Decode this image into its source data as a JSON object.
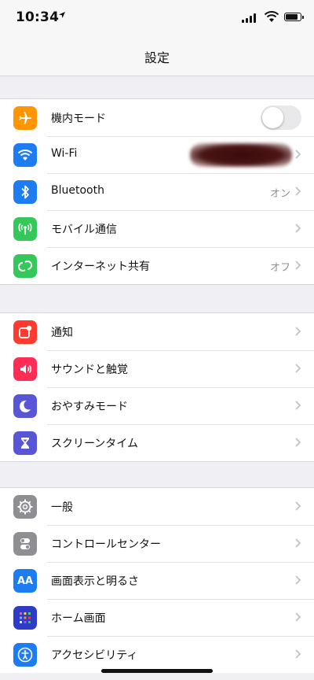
{
  "status_bar": {
    "time": "10:34"
  },
  "nav": {
    "title": "設定"
  },
  "groups": [
    {
      "rows": [
        {
          "label": "機内モード",
          "icon": "airplane-icon",
          "color": "#ff9500",
          "control": "toggle",
          "toggle_on": false
        },
        {
          "label": "Wi-Fi",
          "icon": "wifi-icon",
          "color": "#1e7cf2",
          "control": "redacted"
        },
        {
          "label": "Bluetooth",
          "icon": "bluetooth-icon",
          "color": "#1e7cf2",
          "value": "オン"
        },
        {
          "label": "モバイル通信",
          "icon": "antenna-icon",
          "color": "#34c759"
        },
        {
          "label": "インターネット共有",
          "icon": "hotspot-icon",
          "color": "#34c759",
          "value": "オフ"
        }
      ]
    },
    {
      "rows": [
        {
          "label": "通知",
          "icon": "notification-icon",
          "color": "#ff3b30"
        },
        {
          "label": "サウンドと触覚",
          "icon": "speaker-icon",
          "color": "#ff2d55"
        },
        {
          "label": "おやすみモード",
          "icon": "moon-icon",
          "color": "#5856d6"
        },
        {
          "label": "スクリーンタイム",
          "icon": "hourglass-icon",
          "color": "#5856d6"
        }
      ]
    },
    {
      "rows": [
        {
          "label": "一般",
          "icon": "gear-icon",
          "color": "#8e8e93"
        },
        {
          "label": "コントロールセンター",
          "icon": "switches-icon",
          "color": "#8e8e93"
        },
        {
          "label": "画面表示と明るさ",
          "icon": "text-size-icon",
          "color": "#1e7cf2",
          "icon_text": "AA"
        },
        {
          "label": "ホーム画面",
          "icon": "home-screen-icon",
          "color": "#2d3bc8"
        },
        {
          "label": "アクセシビリティ",
          "icon": "accessibility-icon",
          "color": "#1e7cf2"
        }
      ]
    }
  ]
}
